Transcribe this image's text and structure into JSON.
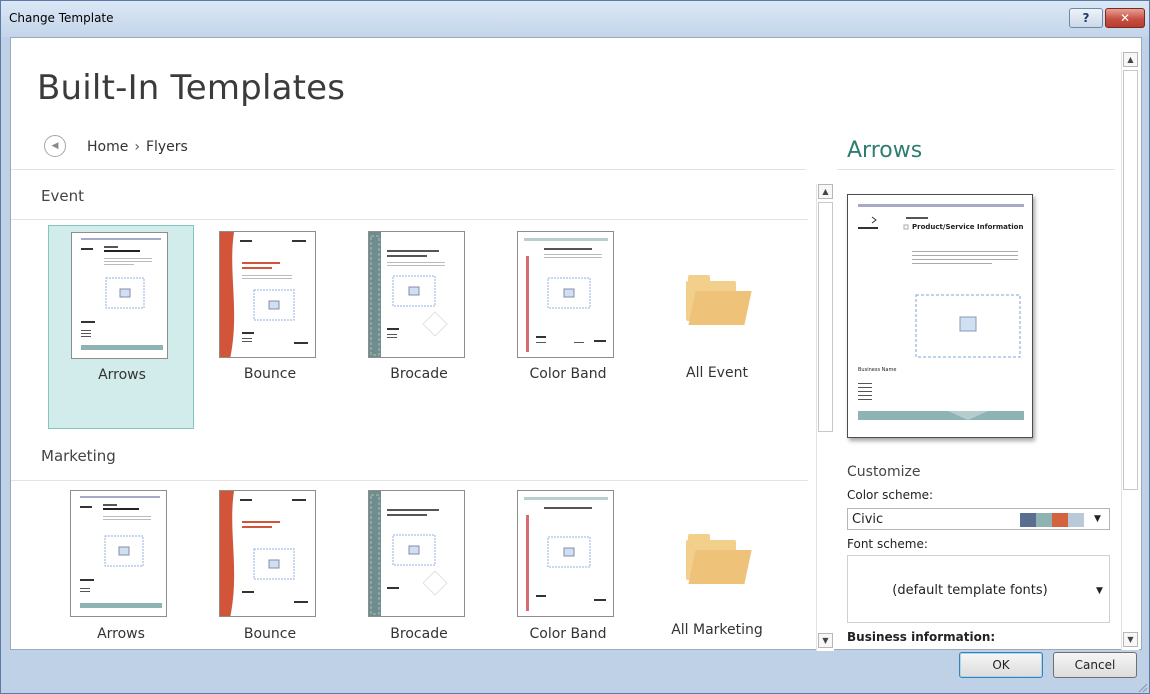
{
  "window": {
    "title": "Change Template",
    "help_label": "?",
    "close_label": "✕"
  },
  "page": {
    "title": "Built-In Templates"
  },
  "nav": {
    "back_icon": "◀",
    "crumbs": [
      "Home",
      "Flyers"
    ],
    "separator": "›"
  },
  "sections": [
    {
      "label": "Event",
      "tiles": [
        "Arrows",
        "Bounce",
        "Brocade",
        "Color Band"
      ],
      "folder_label": "All Event"
    },
    {
      "label": "Marketing",
      "tiles": [
        "Arrows",
        "Bounce",
        "Brocade",
        "Color Band"
      ],
      "folder_label": "All Marketing"
    }
  ],
  "thumb_text": {
    "heading": "Product/Service Information"
  },
  "preview": {
    "title": "Arrows",
    "heading": "Product/Service Information",
    "small": "Business Name"
  },
  "customize": {
    "label": "Customize",
    "color_scheme_label": "Color scheme:",
    "color_scheme_value": "Civic",
    "color_swatches": [
      "#5a6f8f",
      "#8fb3b3",
      "#d4623f",
      "#b9c9d7"
    ],
    "font_scheme_label": "Font scheme:",
    "font_scheme_value": "(default template fonts)",
    "business_info_label": "Business information:"
  },
  "footer": {
    "ok_label": "OK",
    "cancel_label": "Cancel"
  },
  "scroll": {
    "up": "▲",
    "down": "▼"
  },
  "colors": {
    "accent": "#2f7d6f",
    "selected_bg": "#d2eceb"
  }
}
